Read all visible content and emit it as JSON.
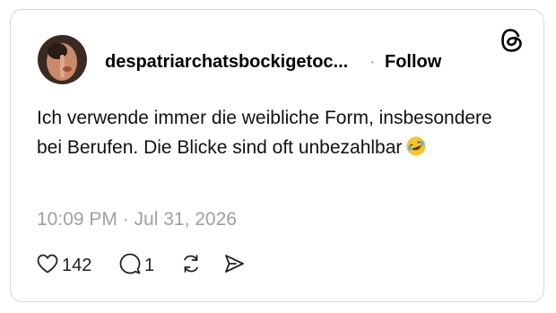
{
  "post": {
    "username": "despatriarchatsbockigetoc...",
    "separator": "·",
    "follow_label": "Follow",
    "text": "Ich verwende immer die weibliche Form, insbesondere bei Berufen. Die Blicke sind oft unbezahlbar",
    "emoji": "rolling-on-floor-laughing",
    "timestamp": "10:09 PM · Jul 31, 2026",
    "likes_count": "142",
    "replies_count": "1"
  },
  "icons": {
    "brand": "threads-logo",
    "like": "heart-icon",
    "reply": "comment-icon",
    "repost": "repost-icon",
    "share": "send-icon"
  },
  "colors": {
    "text": "#000000",
    "muted": "#a0a0a0",
    "border": "#d6d6d6",
    "background": "#ffffff"
  }
}
